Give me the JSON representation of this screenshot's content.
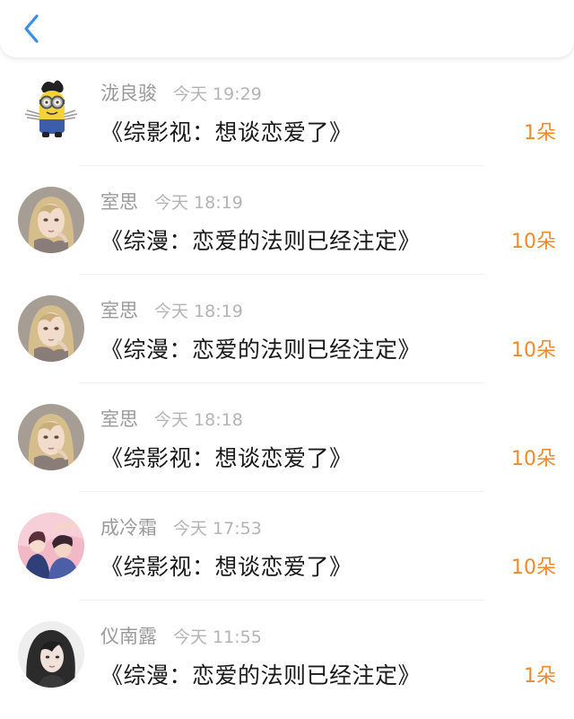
{
  "header": {
    "back_icon": "chevron-left-icon"
  },
  "colors": {
    "back_icon": "#3a8ee6",
    "count_text": "#ef8a2b",
    "name_text": "#9a9a9a",
    "time_text": "#b4b4b4",
    "title_text": "#1a1a1a"
  },
  "messages": [
    {
      "name": "泷良骏",
      "time": "今天 19:29",
      "title": "《综影视：想谈恋爱了》",
      "count": "1朵",
      "avatar": "minion-avatar"
    },
    {
      "name": "室思",
      "time": "今天 18:19",
      "title": "《综漫：恋爱的法则已经注定》",
      "count": "10朵",
      "avatar": "girl-avatar"
    },
    {
      "name": "室思",
      "time": "今天 18:19",
      "title": "《综漫：恋爱的法则已经注定》",
      "count": "10朵",
      "avatar": "girl-avatar"
    },
    {
      "name": "室思",
      "time": "今天 18:18",
      "title": "《综影视：想谈恋爱了》",
      "count": "10朵",
      "avatar": "girl-avatar"
    },
    {
      "name": "成冷霜",
      "time": "今天 17:53",
      "title": "《综影视：想谈恋爱了》",
      "count": "10朵",
      "avatar": "couple-avatar"
    },
    {
      "name": "仪南露",
      "time": "今天 11:55",
      "title": "《综漫：恋爱的法则已经注定》",
      "count": "1朵",
      "avatar": "dark-hair-avatar"
    }
  ]
}
